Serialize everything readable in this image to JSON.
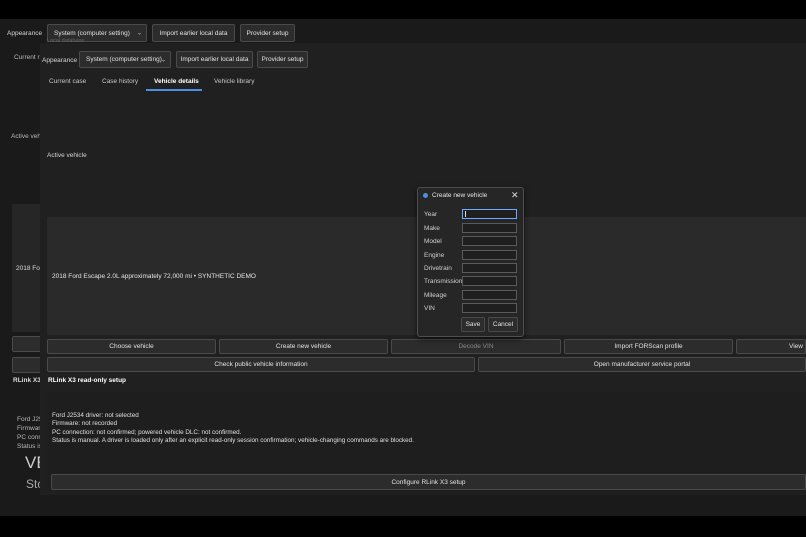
{
  "back_window": {
    "appearance_label": "Appearance",
    "appearance_value": "System (computer setting)",
    "import_label": "Import earlier local data",
    "provider_label": "Provider setup",
    "current_label": "Current r",
    "active_vehicle": "Active vehi",
    "vehicle_short": "2018 For",
    "rlink_short": "RLink X3",
    "ford_short": "Ford J25",
    "firmware_short": "Firmwar",
    "pc_short": "PC conn",
    "status_short": "Status is",
    "ve_big": "VE",
    "sto_big": "Sto",
    "subtitle": "Local database"
  },
  "toolbar": {
    "appearance_label": "Appearance",
    "appearance_value": "System (computer setting)",
    "import_label": "Import earlier local data",
    "provider_label": "Provider setup"
  },
  "tabs": [
    "Current case",
    "Case history",
    "Vehicle details",
    "Vehicle library"
  ],
  "active_vehicle_label": "Active vehicle",
  "vehicle_summary": "2018 Ford Escape 2.0L approximately 72,000 mi  • SYNTHETIC DEMO",
  "actions": {
    "choose": "Choose vehicle",
    "create": "Create new vehicle",
    "decode": "Decode VIN",
    "import_forscan": "Import FORScan profile",
    "view": "View",
    "check_public": "Check public vehicle information",
    "open_portal": "Open manufacturer service portal"
  },
  "rlink": {
    "heading": "RLink X3 read-only setup",
    "line1": "Ford J2534 driver: not selected",
    "line2": "Firmware: not recorded",
    "line3": "PC connection: not confirmed; powered vehicle DLC: not confirmed.",
    "line4": "Status is manual. A driver is loaded only after an explicit read-only session confirmation; vehicle-changing commands are blocked.",
    "configure": "Configure RLink X3 setup"
  },
  "dialog": {
    "title": "Create new vehicle",
    "fields": [
      "Year",
      "Make",
      "Model",
      "Engine",
      "Drivetrain",
      "Transmission",
      "Mileage",
      "VIN"
    ],
    "save": "Save",
    "cancel": "Cancel"
  }
}
